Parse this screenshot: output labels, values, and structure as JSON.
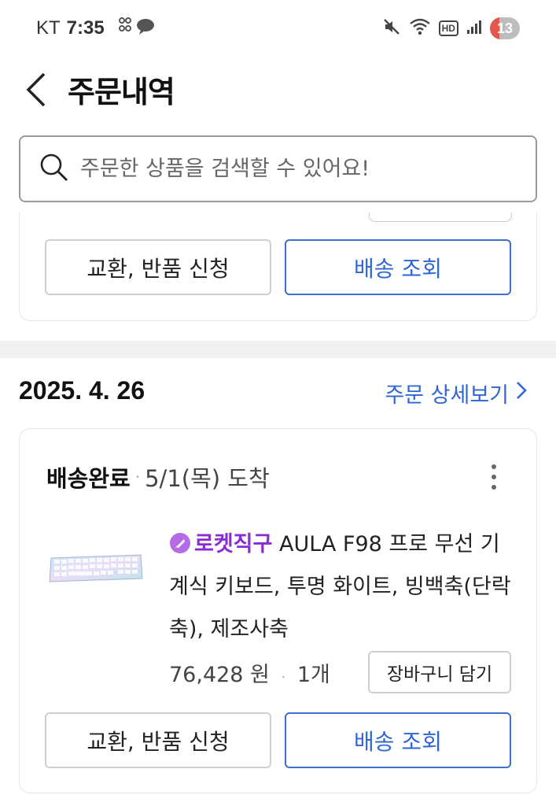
{
  "status_bar": {
    "carrier": "KT",
    "time": "7:35",
    "battery": "13",
    "hd": "HD"
  },
  "header": {
    "title": "주문내역"
  },
  "search": {
    "placeholder": "주문한 상품을 검색할 수 있어요!"
  },
  "top_card": {
    "exchange_label": "교환, 반품 신청",
    "track_label": "배송 조회"
  },
  "order": {
    "date": "2025. 4. 26",
    "detail_link": "주문 상세보기",
    "status": "배송완료",
    "arrival": "5/1(목) 도착",
    "item": {
      "brand": "로켓직구",
      "name": "AULA F98 프로 무선 기계식 키보드, 투명 화이트, 빙백축(단락축), 제조사축",
      "price": "76,428 원",
      "quantity": "1개"
    },
    "cart_label": "장바구니 담기",
    "exchange_label": "교환, 반품 신청",
    "track_label": "배송 조회"
  },
  "colors": {
    "accent_blue": "#2f65d6",
    "rocket_purple": "#8b2bd6"
  }
}
